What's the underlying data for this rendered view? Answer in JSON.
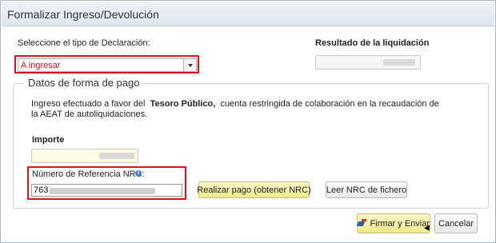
{
  "dialog": {
    "title": "Formalizar Ingreso/Devolución"
  },
  "declaration": {
    "label": "Seleccione el tipo de Declaración:",
    "selected": "A ingresar"
  },
  "result": {
    "label": "Resultado de la liquidación"
  },
  "payment": {
    "legend": "Datos de forma de pago",
    "info_prefix": "Ingreso efectuado a favor del",
    "info_bold": "Tesoro Público,",
    "info_suffix": "cuenta restringida de colaboración en la recaudación de la AEAT de autoliquidaciones.",
    "amount_label": "Importe",
    "nrc_label": "Número de Referencia  NRC:",
    "nrc_value": "763",
    "pay_button": "Realizar pago (obtener NRC)",
    "read_file_button": "Leer NRC de fichero"
  },
  "footer": {
    "sign_send_button": "Firmar y Enviar",
    "cancel_button": "Cancelar"
  },
  "colors": {
    "highlight": "#e0101c",
    "button_yellow": "#f1e98c"
  }
}
